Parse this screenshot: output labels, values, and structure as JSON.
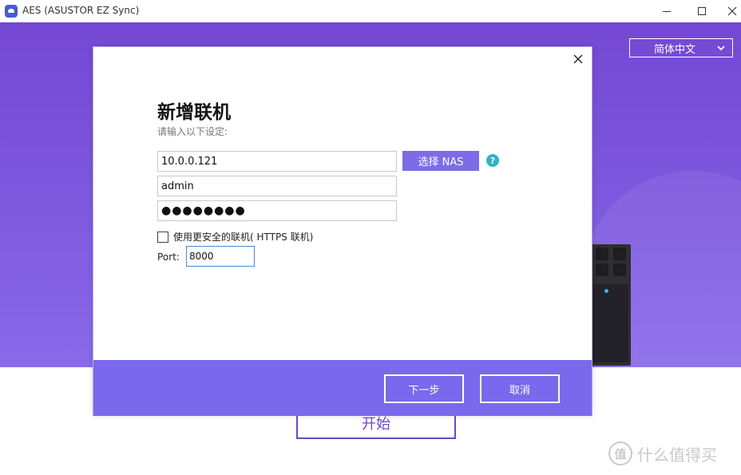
{
  "window": {
    "title": "AES (ASUSTOR EZ Sync)"
  },
  "language": {
    "selected": "简体中文"
  },
  "dialog": {
    "title": "新增联机",
    "subtitle": "请输入以下设定:",
    "host_value": "10.0.0.121",
    "username_value": "admin",
    "password_mask": "●●●●●●●●",
    "select_nas_label": "选择 NAS",
    "help_label": "?",
    "https_label": "使用更安全的联机( HTTPS 联机)",
    "https_checked": false,
    "port_label": "Port:",
    "port_value": "8000",
    "next_label": "下一步",
    "cancel_label": "取消"
  },
  "main": {
    "start_label": "开始"
  },
  "watermark": {
    "logo_text": "值",
    "text": "什么值得买"
  },
  "colors": {
    "hero_purple": "#7448d3",
    "dialog_footer": "#7a69ec",
    "select_nas_button": "#7c6ce8",
    "help_icon": "#2fb3c7",
    "start_border": "#6f46c9"
  },
  "icons": {
    "app": "app-cloud-icon",
    "minimize": "minimize-icon",
    "maximize": "maximize-icon",
    "close": "close-icon",
    "dropdown": "chevron-down-icon",
    "help": "help-icon",
    "dialog_close": "close-icon"
  }
}
